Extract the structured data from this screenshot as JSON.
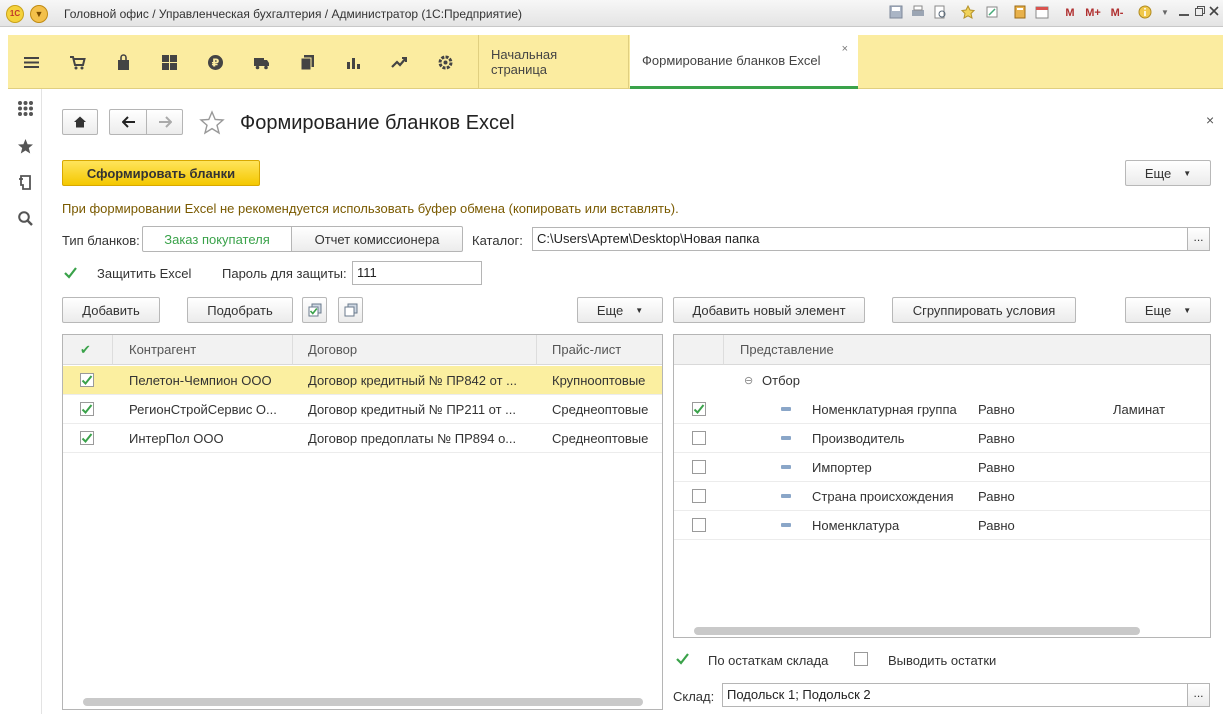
{
  "window": {
    "title": "Головной офис / Управленческая бухгалтерия / Администратор  (1С:Предприятие)",
    "logo_text": "1С",
    "toolbar_icons": [
      "save-icon",
      "print-icon",
      "print-preview-icon",
      "history-icon",
      "favorite-add-icon",
      "link-icon",
      "calculator-icon",
      "calendar-icon",
      "memory-m-icon",
      "memory-plus-icon",
      "memory-minus-icon",
      "info-icon",
      "minimize-icon",
      "restore-icon",
      "close-icon"
    ],
    "toolbar_labels": {
      "m": "M",
      "mplus": "M+",
      "mminus": "M-"
    }
  },
  "sections": {
    "icons": [
      "menu-icon",
      "cart-icon",
      "shopping-bag-icon",
      "warehouse-grid-icon",
      "ruble-icon",
      "truck-icon",
      "documents-icon",
      "bar-chart-icon",
      "trend-icon",
      "gear-icon"
    ],
    "tabs": [
      {
        "label": "Начальная страница",
        "active": false
      },
      {
        "label": "Формирование бланков Excel",
        "active": true
      }
    ],
    "tab_close": "×"
  },
  "left_panel": {
    "icons": [
      "apps-grid-icon",
      "star-icon",
      "history-list-icon",
      "search-icon"
    ]
  },
  "form": {
    "title": "Формирование бланков Excel",
    "close": "×",
    "generate_button": "Сформировать бланки",
    "more_button": "Еще",
    "warning": "При формировании Excel не рекомендуется использовать буфер обмена (копировать или вставлять).",
    "blank_type_label": "Тип бланков:",
    "blank_types": [
      {
        "label": "Заказ покупателя",
        "active": true
      },
      {
        "label": "Отчет комиссионера",
        "active": false
      }
    ],
    "catalog_label": "Каталог:",
    "catalog_value": "C:\\Users\\Артем\\Desktop\\Новая папка",
    "select_button": "...",
    "protect_label": "Защитить Excel",
    "protect_checked": true,
    "password_label": "Пароль для защиты:",
    "password_value": "111",
    "accent_color": "#3aa24a",
    "yellow_button_color": "#f4c800"
  },
  "left_table": {
    "buttons": {
      "add": "Добавить",
      "pick": "Подобрать",
      "more": "Еще"
    },
    "headers": {
      "check": "✔",
      "contractor": "Контрагент",
      "contract": "Договор",
      "pricelist": "Прайс-лист"
    },
    "rows": [
      {
        "checked": true,
        "contractor": "Пелетон-Чемпион ООО",
        "contract": "Договор кредитный № ПР842 от ...",
        "pricelist": "Крупнооптовые",
        "selected": true
      },
      {
        "checked": true,
        "contractor": "РегионСтройСервис О...",
        "contract": "Договор кредитный № ПР211 от ...",
        "pricelist": "Среднеоптовые",
        "selected": false
      },
      {
        "checked": true,
        "contractor": "ИнтерПол ООО",
        "contract": "Договор предоплаты № ПР894 о...",
        "pricelist": "Среднеоптовые",
        "selected": false
      }
    ]
  },
  "right_table": {
    "buttons": {
      "add_element": "Добавить новый элемент",
      "group": "Сгруппировать условия",
      "more": "Еще"
    },
    "headers": {
      "representation": "Представление"
    },
    "group_label": "Отбор",
    "collapse_glyph": "⊖",
    "rows": [
      {
        "checked": true,
        "field": "Номенклатурная группа",
        "condition": "Равно",
        "value": "Ламинат"
      },
      {
        "checked": false,
        "field": "Производитель",
        "condition": "Равно",
        "value": ""
      },
      {
        "checked": false,
        "field": "Импортер",
        "condition": "Равно",
        "value": ""
      },
      {
        "checked": false,
        "field": "Страна происхождения",
        "condition": "Равно",
        "value": ""
      },
      {
        "checked": false,
        "field": "Номенклатура",
        "condition": "Равно",
        "value": ""
      }
    ]
  },
  "bottom": {
    "by_stock_label": "По остаткам склада",
    "by_stock_checked": true,
    "show_stock_label": "Выводить остатки",
    "show_stock_checked": false,
    "warehouse_label": "Склад:",
    "warehouse_value": "Подольск 1; Подольск 2",
    "select_button": "..."
  }
}
